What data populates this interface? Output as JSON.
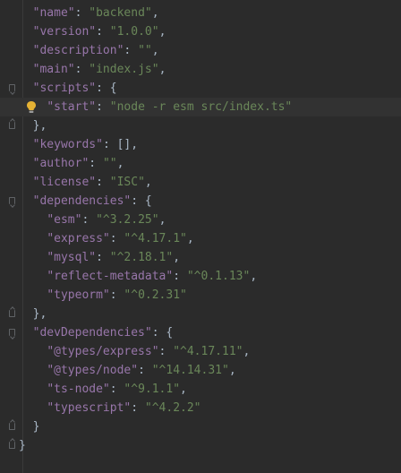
{
  "colors": {
    "background": "#2b2b2b",
    "key": "#9876aa",
    "string": "#6a8759",
    "punctuation": "#a9b7c6",
    "current_line": "#323232",
    "bulb": "#e5b234"
  },
  "lines": [
    {
      "indent": "  ",
      "key": "\"name\"",
      "sep": ": ",
      "value": "\"backend\"",
      "end": ","
    },
    {
      "indent": "  ",
      "key": "\"version\"",
      "sep": ": ",
      "value": "\"1.0.0\"",
      "end": ","
    },
    {
      "indent": "  ",
      "key": "\"description\"",
      "sep": ": ",
      "value": "\"\"",
      "end": ","
    },
    {
      "indent": "  ",
      "key": "\"main\"",
      "sep": ": ",
      "value": "\"index.js\"",
      "end": ","
    },
    {
      "indent": "  ",
      "key": "\"scripts\"",
      "sep": ": {",
      "value": "",
      "end": "",
      "fold": "open"
    },
    {
      "indent": "    ",
      "key": "\"start\"",
      "sep": ": ",
      "value": "\"node -r esm src/index.ts\"",
      "end": "",
      "current": true,
      "bulb": true
    },
    {
      "indent": "  ",
      "key": "",
      "sep": "},",
      "value": "",
      "end": "",
      "fold": "close"
    },
    {
      "indent": "  ",
      "key": "\"keywords\"",
      "sep": ": [],",
      "value": "",
      "end": ""
    },
    {
      "indent": "  ",
      "key": "\"author\"",
      "sep": ": ",
      "value": "\"\"",
      "end": ","
    },
    {
      "indent": "  ",
      "key": "\"license\"",
      "sep": ": ",
      "value": "\"ISC\"",
      "end": ","
    },
    {
      "indent": "  ",
      "key": "\"dependencies\"",
      "sep": ": {",
      "value": "",
      "end": "",
      "fold": "open"
    },
    {
      "indent": "    ",
      "key": "\"esm\"",
      "sep": ": ",
      "value": "\"^3.2.25\"",
      "end": ","
    },
    {
      "indent": "    ",
      "key": "\"express\"",
      "sep": ": ",
      "value": "\"^4.17.1\"",
      "end": ","
    },
    {
      "indent": "    ",
      "key": "\"mysql\"",
      "sep": ": ",
      "value": "\"^2.18.1\"",
      "end": ","
    },
    {
      "indent": "    ",
      "key": "\"reflect-metadata\"",
      "sep": ": ",
      "value": "\"^0.1.13\"",
      "end": ","
    },
    {
      "indent": "    ",
      "key": "\"typeorm\"",
      "sep": ": ",
      "value": "\"^0.2.31\"",
      "end": ""
    },
    {
      "indent": "  ",
      "key": "",
      "sep": "},",
      "value": "",
      "end": "",
      "fold": "close"
    },
    {
      "indent": "  ",
      "key": "\"devDependencies\"",
      "sep": ": {",
      "value": "",
      "end": "",
      "fold": "open"
    },
    {
      "indent": "    ",
      "key": "\"@types/express\"",
      "sep": ": ",
      "value": "\"^4.17.11\"",
      "end": ","
    },
    {
      "indent": "    ",
      "key": "\"@types/node\"",
      "sep": ": ",
      "value": "\"^14.14.31\"",
      "end": ","
    },
    {
      "indent": "    ",
      "key": "\"ts-node\"",
      "sep": ": ",
      "value": "\"^9.1.1\"",
      "end": ","
    },
    {
      "indent": "    ",
      "key": "\"typescript\"",
      "sep": ": ",
      "value": "\"^4.2.2\"",
      "end": ""
    },
    {
      "indent": "  ",
      "key": "",
      "sep": "}",
      "value": "",
      "end": "",
      "fold": "close"
    },
    {
      "indent": "",
      "key": "",
      "sep": "}",
      "value": "",
      "end": "",
      "fold": "close"
    }
  ]
}
